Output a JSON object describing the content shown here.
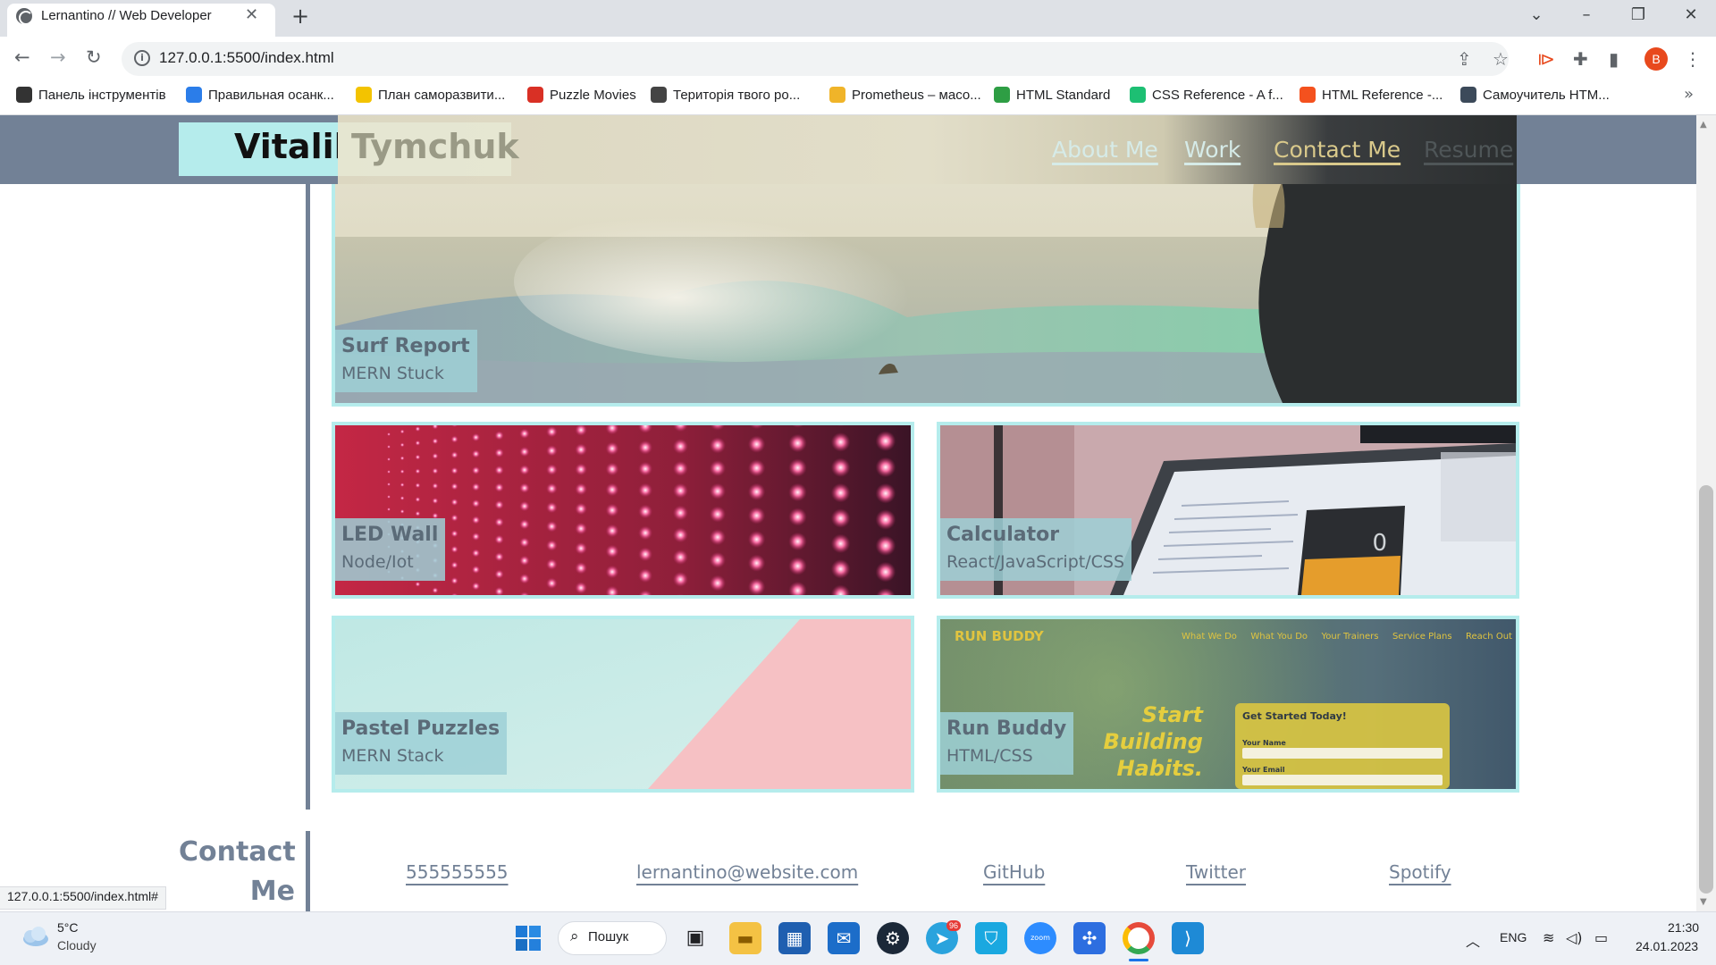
{
  "browser": {
    "tab_title": "Lernantino // Web Developer",
    "url": "127.0.0.1:5500/index.html",
    "profile_initial": "B",
    "bookmarks": [
      {
        "label": "Панель інструментів",
        "color": "#333333"
      },
      {
        "label": "Правильная осанк...",
        "color": "#2b7de9"
      },
      {
        "label": "План саморазвити...",
        "color": "#f3c300"
      },
      {
        "label": "Puzzle Movies",
        "color": "#d93025"
      },
      {
        "label": "Територія твого ро...",
        "color": "#444444"
      },
      {
        "label": "Prometheus – масо...",
        "color": "#f0b429"
      },
      {
        "label": "HTML Standard",
        "color": "#2e9e44"
      },
      {
        "label": "CSS Reference - A f...",
        "color": "#1dbf73"
      },
      {
        "label": "HTML Reference -...",
        "color": "#f4511e"
      },
      {
        "label": "Самоучитель HTM...",
        "color": "#3c4a5a"
      }
    ]
  },
  "site": {
    "brand_first": "Vitalik",
    "brand_last": "Tymchuk",
    "nav": [
      "About Me",
      "Work",
      "Contact Me",
      "Resume"
    ],
    "projects": [
      {
        "title": "Surf Report",
        "subtitle": "MERN Stuck"
      },
      {
        "title": "LED Wall",
        "subtitle": "Node/Iot"
      },
      {
        "title": "Calculator",
        "subtitle": "React/JavaScript/CSS"
      },
      {
        "title": "Pastel Puzzles",
        "subtitle": "MERN Stack"
      },
      {
        "title": "Run Buddy",
        "subtitle": "HTML/CSS"
      }
    ],
    "calc_display": "0",
    "runbuddy": {
      "logo": "RUN BUDDY",
      "nav": [
        "What We Do",
        "What You Do",
        "Your Trainers",
        "Service Plans",
        "Reach Out"
      ],
      "headline": "Start Building Habits.",
      "form_title": "Get Started Today!",
      "form_name_label": "Your Name",
      "form_email_label": "Your Email"
    },
    "contact_title": "Contact Me",
    "contact_links": [
      "555555555",
      "lernantino@website.com",
      "GitHub",
      "Twitter",
      "Spotify"
    ]
  },
  "status_url": "127.0.0.1:5500/index.html#",
  "taskbar": {
    "weather_temp": "5°C",
    "weather_cond": "Cloudy",
    "search_label": "Пошук",
    "telegram_badge": "96",
    "lang": "ENG",
    "time": "21:30",
    "date": "24.01.2023"
  },
  "colors": {
    "header": "#728196",
    "accent": "#b5ecec",
    "nav_text": "#d6ebe8"
  }
}
